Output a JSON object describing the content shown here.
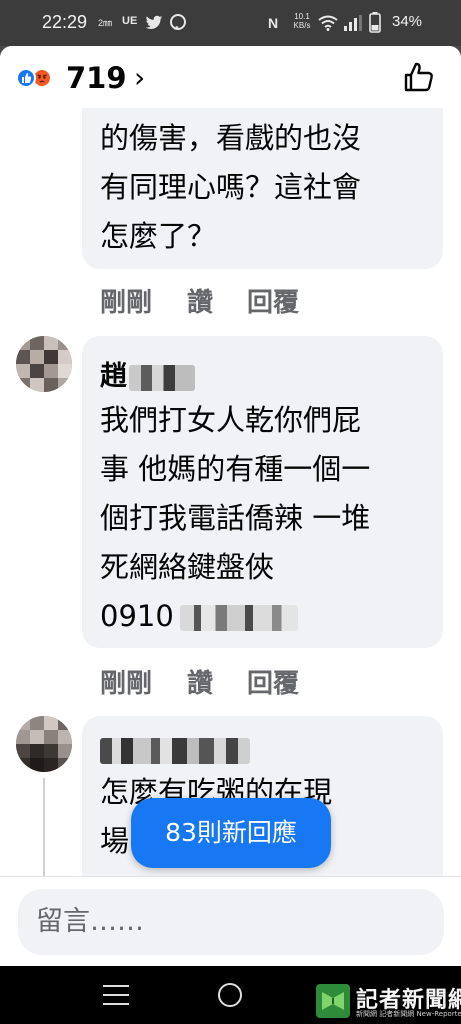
{
  "status_bar": {
    "time": "22:29",
    "indicators": [
      "2㎜",
      "UE"
    ],
    "network_speed_value": "10.1",
    "network_speed_unit": "KB/s",
    "nfc": "N",
    "battery": "34%"
  },
  "header": {
    "reaction_count": "719",
    "reactions": [
      "like-icon",
      "angry-icon"
    ],
    "chevron": "›"
  },
  "comments": [
    {
      "text_lines": [
        "的傷害，看戲的也沒",
        "有同理心嗎？這社會",
        "怎麼了？"
      ],
      "actions": {
        "time": "剛剛",
        "like": "讚",
        "reply": "回覆"
      }
    },
    {
      "author": "趙",
      "text_lines": [
        "我們打女人乾你們屁",
        "事 他媽的有種一個一",
        "個打我電話僑辣 一堆",
        "死網絡鍵盤俠",
        "0910"
      ],
      "actions": {
        "time": "剛剛",
        "like": "讚",
        "reply": "回覆"
      }
    },
    {
      "text_lines": [
        "怎麼有吃粥的在現",
        "場"
      ]
    }
  ],
  "new_replies_button": "83則新回應",
  "composer": {
    "placeholder": "留言……"
  },
  "watermark": {
    "title": "記者新聞網",
    "subtitle": "新聞網 記者新聞網 New-Reporter"
  },
  "colors": {
    "accent": "#1877f2",
    "bubble": "#f0f2f5",
    "secondary_text": "#65676b"
  }
}
